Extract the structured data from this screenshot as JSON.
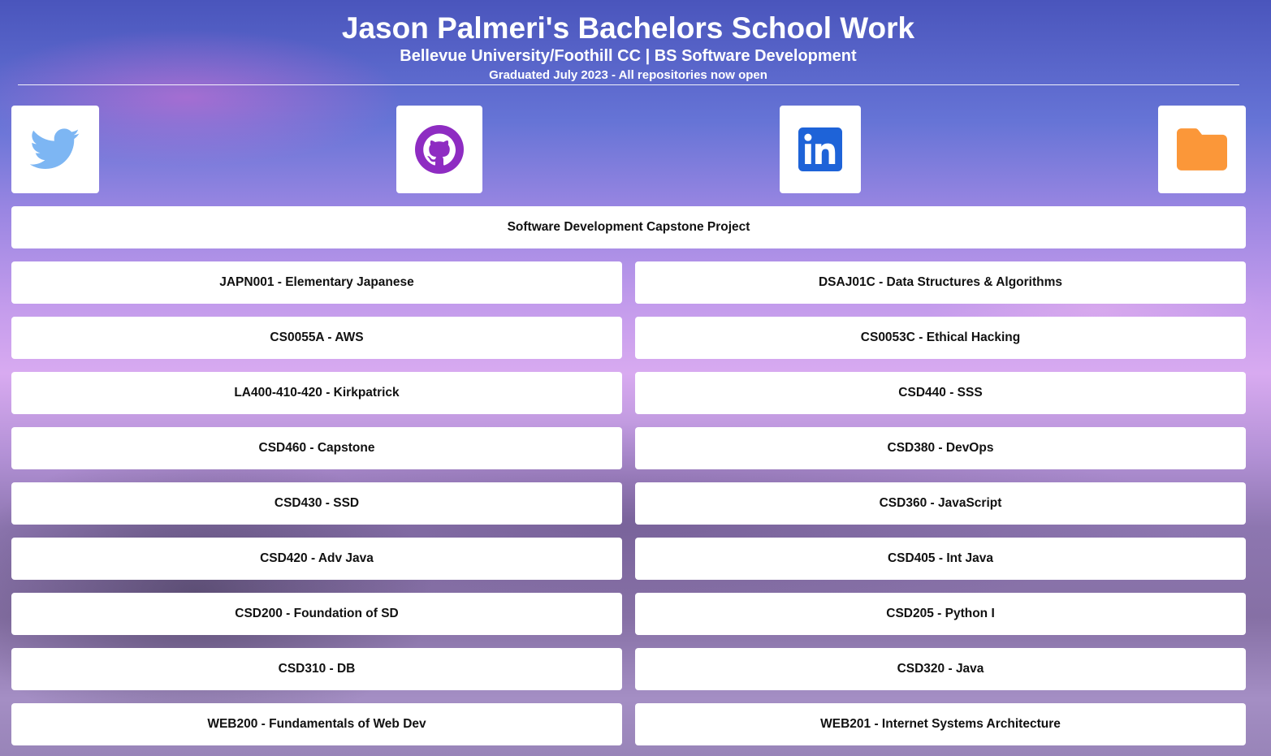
{
  "header": {
    "title": "Jason Palmeri's Bachelors School Work",
    "subtitle": "Bellevue University/Foothill CC | BS Software Development",
    "note": "Graduated July 2023 - All repositories now open"
  },
  "social_icons": [
    "twitter-icon",
    "github-icon",
    "linkedin-icon",
    "folder-icon"
  ],
  "colors": {
    "twitter": "#7db6f3",
    "github": "#8e2cc2",
    "linkedin": "#1e63d8",
    "folder": "#fb9739"
  },
  "capstone": {
    "label": "Software Development Capstone Project"
  },
  "courses": {
    "left": [
      "JAPN001 - Elementary Japanese",
      "CS0055A - AWS",
      "LA400-410-420 - Kirkpatrick",
      "CSD460 - Capstone",
      "CSD430 - SSD",
      "CSD420 - Adv Java",
      "CSD200 - Foundation of SD",
      "CSD310 - DB",
      "WEB200 - Fundamentals of Web Dev"
    ],
    "right": [
      "DSAJ01C - Data Structures & Algorithms",
      "CS0053C - Ethical Hacking",
      "CSD440 - SSS",
      "CSD380 - DevOps",
      "CSD360 - JavaScript",
      "CSD405 - Int Java",
      "CSD205 - Python I",
      "CSD320 - Java",
      "WEB201 - Internet Systems Architecture"
    ]
  }
}
